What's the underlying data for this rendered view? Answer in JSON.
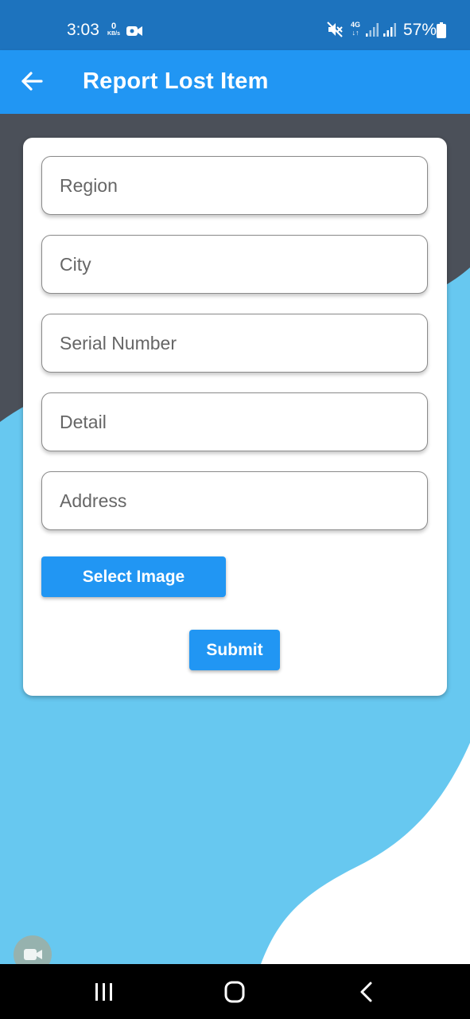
{
  "status_bar": {
    "time": "3:03",
    "data_rate_value": "0",
    "data_rate_unit": "KB/s",
    "network_type": "4G",
    "battery_percent": "57%",
    "icons": [
      "video-record-icon",
      "mute-icon",
      "4g-data-icon",
      "signal-icon",
      "signal-icon",
      "battery-icon"
    ]
  },
  "app_bar": {
    "title": "Report Lost Item",
    "back_icon": "arrow-left-icon"
  },
  "form": {
    "fields": [
      {
        "placeholder": "Region",
        "value": ""
      },
      {
        "placeholder": "City",
        "value": ""
      },
      {
        "placeholder": "Serial Number",
        "value": ""
      },
      {
        "placeholder": "Detail",
        "value": ""
      },
      {
        "placeholder": "Address",
        "value": ""
      }
    ],
    "select_image_label": "Select Image",
    "submit_label": "Submit"
  },
  "nav_bar": {
    "icons": [
      "recent-apps-icon",
      "home-icon",
      "back-icon"
    ]
  },
  "colors": {
    "status_bar": "#1d73be",
    "app_bar": "#2196f3",
    "button": "#2196f3",
    "background_dark": "#4b5059",
    "background_wave": "#67c8f0",
    "background_light": "#ffffff"
  }
}
